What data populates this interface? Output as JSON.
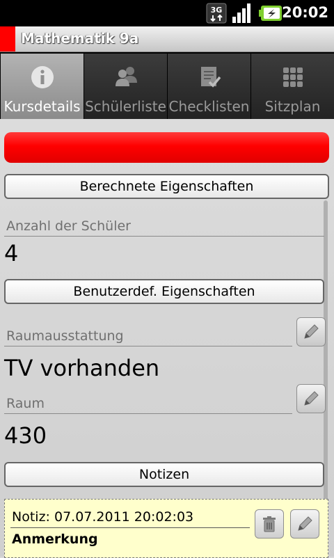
{
  "status_bar": {
    "network": "3G",
    "time": "20:02",
    "icons": [
      "3g-icon",
      "signal-icon",
      "battery-charging-icon"
    ]
  },
  "titlebar": {
    "title": "Mathematik 9a",
    "accent_color": "#ff0000"
  },
  "tabs": [
    {
      "label": "Kursdetails",
      "icon": "info-icon",
      "active": true
    },
    {
      "label": "Schülerliste",
      "icon": "people-icon",
      "active": false
    },
    {
      "label": "Checklisten",
      "icon": "checklist-icon",
      "active": false
    },
    {
      "label": "Sitzplan",
      "icon": "grid-icon",
      "active": false
    }
  ],
  "course_color": "#ff0000",
  "computed_section": {
    "button_label": "Berechnete Eigenschaften",
    "student_count_label": "Anzahl der Schüler",
    "student_count_value": "4"
  },
  "custom_section": {
    "button_label": "Benutzerdef. Eigenschaften",
    "properties": [
      {
        "label": "Raumausstattung",
        "value": "TV vorhanden",
        "edit_icon": "pencil-icon"
      },
      {
        "label": "Raum",
        "value": "430",
        "edit_icon": "pencil-icon"
      }
    ]
  },
  "notes_section": {
    "button_label": "Notizen",
    "notes": [
      {
        "header": "Notiz: 07.07.2011 20:02:03",
        "text": "Anmerkung",
        "delete_icon": "trash-icon",
        "edit_icon": "pencil-icon"
      }
    ]
  }
}
